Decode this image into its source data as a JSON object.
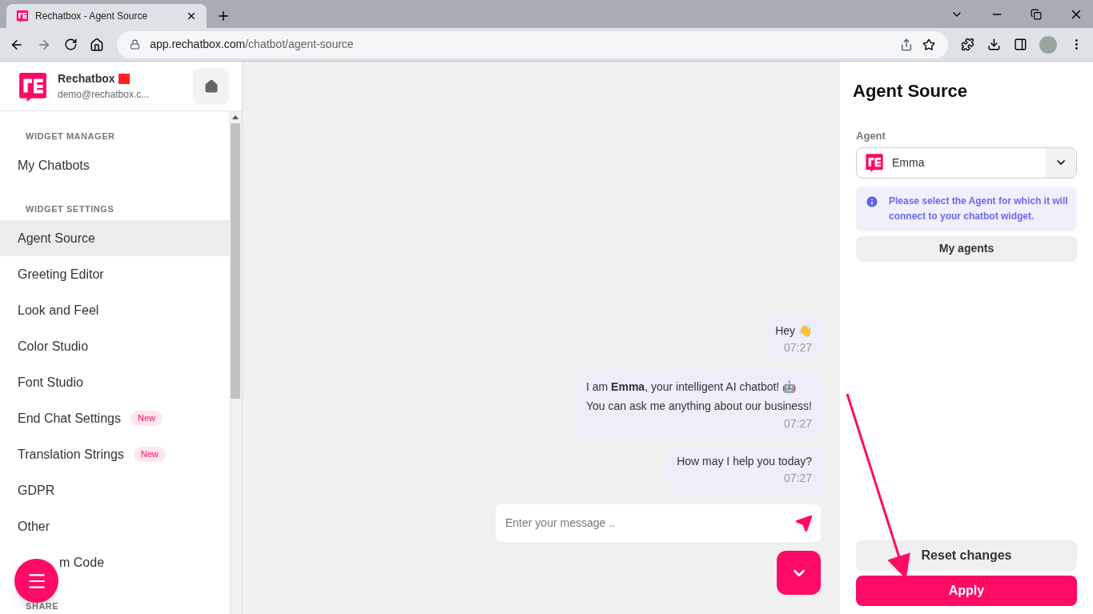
{
  "browser": {
    "tab_title": "Rechatbox - Agent Source",
    "url_host": "app.rechatbox.com",
    "url_path": "/chatbot/agent-source"
  },
  "sidebar": {
    "brand": "Rechatbox",
    "email": "demo@rechatbox.c...",
    "sections": [
      {
        "heading": "WIDGET MANAGER",
        "items": [
          {
            "label": "My Chatbots",
            "selected": false
          }
        ]
      },
      {
        "heading": "WIDGET SETTINGS",
        "items": [
          {
            "label": "Agent Source",
            "selected": true
          },
          {
            "label": "Greeting Editor",
            "selected": false
          },
          {
            "label": "Look and Feel",
            "selected": false
          },
          {
            "label": "Color Studio",
            "selected": false
          },
          {
            "label": "Font Studio",
            "selected": false
          },
          {
            "label": "End Chat Settings",
            "selected": false,
            "badge": "New"
          },
          {
            "label": "Translation Strings",
            "selected": false,
            "badge": "New"
          },
          {
            "label": "GDPR",
            "selected": false
          },
          {
            "label": "Other",
            "selected": false
          },
          {
            "label": "m Code",
            "selected": false,
            "covered": true
          }
        ]
      },
      {
        "heading": "SHARE"
      }
    ]
  },
  "chat": {
    "messages": [
      {
        "text": "Hey 👋",
        "time": "07:27"
      },
      {
        "lines": [
          "I am **Emma**, your intelligent AI chatbot! 🤖",
          "You can ask me anything about our business!"
        ],
        "time": "07:27"
      },
      {
        "text": "How may I help you today?",
        "time": "07:27"
      }
    ],
    "input": {
      "placeholder": "Enter your message .."
    }
  },
  "panel": {
    "title": "Agent Source",
    "field_label": "Agent",
    "agent": "Emma",
    "info": "Please select the Agent for which it will connect to your chatbot widget.",
    "my_agents": "My agents",
    "reset": "Reset changes",
    "apply": "Apply"
  }
}
